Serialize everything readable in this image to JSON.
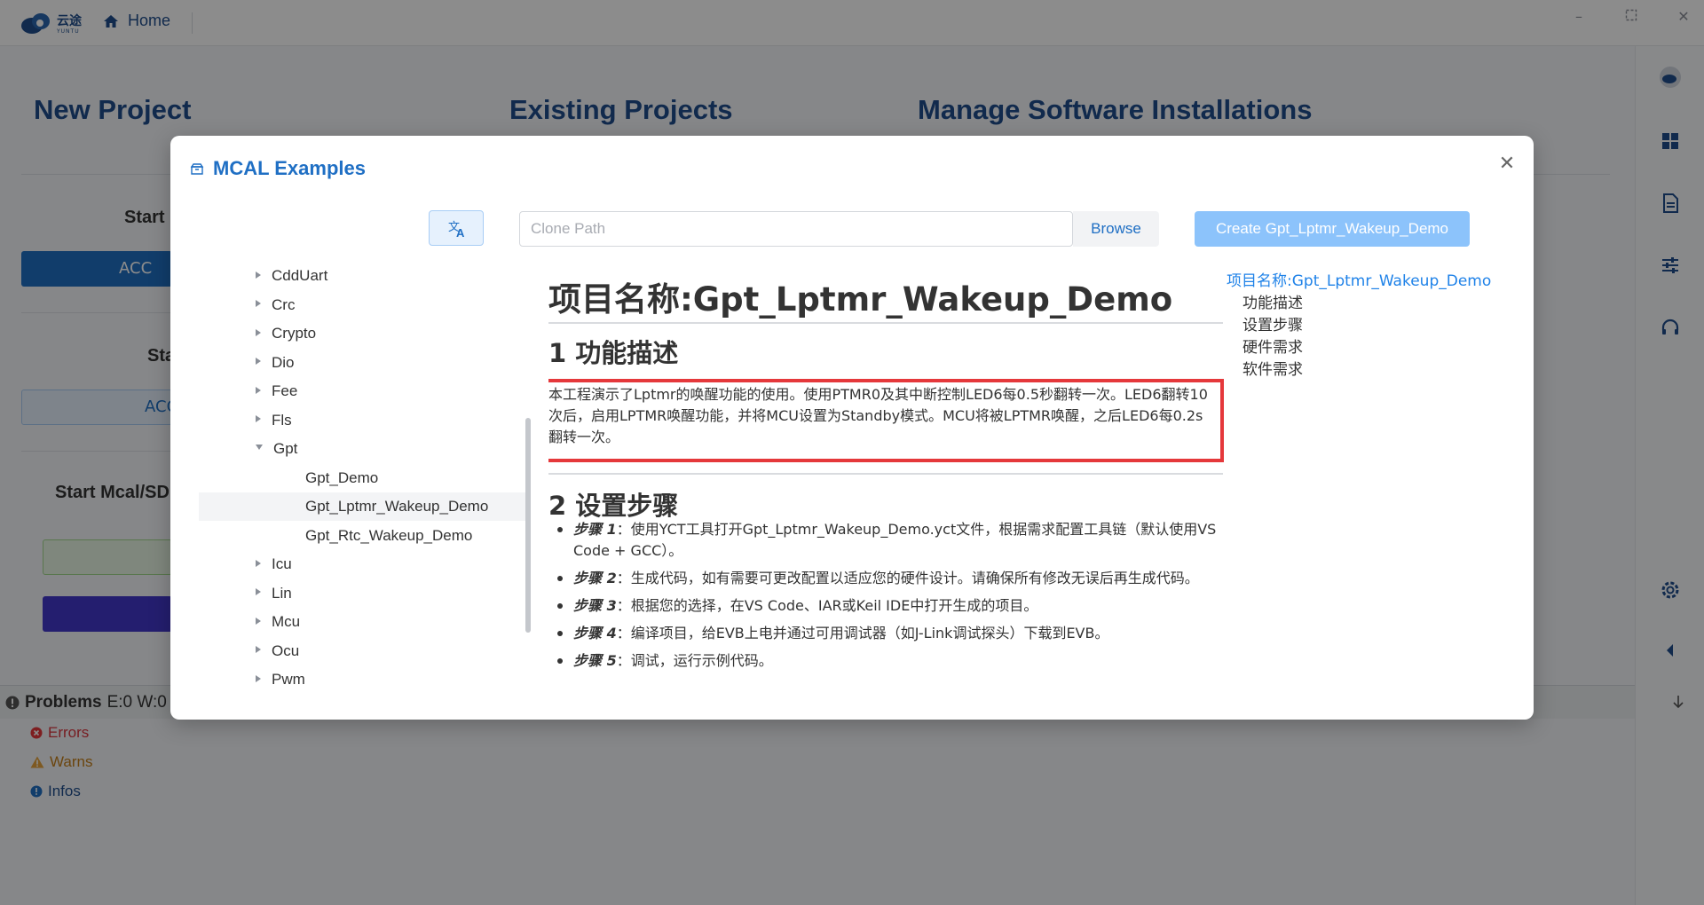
{
  "app": {
    "brand": "云途",
    "brand_sub": "YUNTU",
    "home_label": "Home"
  },
  "sections": {
    "new_project": "New Project",
    "existing_projects": "Existing Projects",
    "manage_software": "Manage Software Installations"
  },
  "background": {
    "start_label": "Start",
    "start_btn_1": "ACC",
    "sta_label": "Sta",
    "start_btn_2": "ACC",
    "start_mcal_label": "Start Mcal/SD"
  },
  "problems": {
    "title": "Problems",
    "counts": "E:0 W:0",
    "errors": "Errors",
    "warns": "Warns",
    "infos": "Infos"
  },
  "modal": {
    "title": "MCAL Examples",
    "clone_placeholder": "Clone Path",
    "browse_label": "Browse",
    "create_label": "Create Gpt_Lptmr_Wakeup_Demo"
  },
  "tree": [
    {
      "label": "CddUart",
      "level": 0,
      "expanded": false,
      "selected": false
    },
    {
      "label": "Crc",
      "level": 0,
      "expanded": false,
      "selected": false
    },
    {
      "label": "Crypto",
      "level": 0,
      "expanded": false,
      "selected": false
    },
    {
      "label": "Dio",
      "level": 0,
      "expanded": false,
      "selected": false
    },
    {
      "label": "Fee",
      "level": 0,
      "expanded": false,
      "selected": false
    },
    {
      "label": "Fls",
      "level": 0,
      "expanded": false,
      "selected": false
    },
    {
      "label": "Gpt",
      "level": 0,
      "expanded": true,
      "selected": false
    },
    {
      "label": "Gpt_Demo",
      "level": 1,
      "expanded": false,
      "selected": false
    },
    {
      "label": "Gpt_Lptmr_Wakeup_Demo",
      "level": 1,
      "expanded": false,
      "selected": true
    },
    {
      "label": "Gpt_Rtc_Wakeup_Demo",
      "level": 1,
      "expanded": false,
      "selected": false
    },
    {
      "label": "Icu",
      "level": 0,
      "expanded": false,
      "selected": false
    },
    {
      "label": "Lin",
      "level": 0,
      "expanded": false,
      "selected": false
    },
    {
      "label": "Mcu",
      "level": 0,
      "expanded": false,
      "selected": false
    },
    {
      "label": "Ocu",
      "level": 0,
      "expanded": false,
      "selected": false
    },
    {
      "label": "Pwm",
      "level": 0,
      "expanded": false,
      "selected": false
    }
  ],
  "doc": {
    "h1": "项目名称:Gpt_Lptmr_Wakeup_Demo",
    "h2_1": "1 功能描述",
    "description": "本工程演示了Lptmr的唤醒功能的使用。使用PTMR0及其中断控制LED6每0.5秒翻转一次。LED6翻转10次后，启用LPTMR唤醒功能，并将MCU设置为Standby模式。MCU将被LPTMR唤醒，之后LED6每0.2s翻转一次。",
    "h2_2": "2 设置步骤",
    "steps": [
      {
        "label": "步骤 1",
        "text": "：使用YCT工具打开Gpt_Lptmr_Wakeup_Demo.yct文件，根据需求配置工具链（默认使用VS Code + GCC）。"
      },
      {
        "label": "步骤 2",
        "text": "：生成代码，如有需要可更改配置以适应您的硬件设计。请确保所有修改无误后再生成代码。"
      },
      {
        "label": "步骤 3",
        "text": "：根据您的选择，在VS Code、IAR或Keil IDE中打开生成的项目。"
      },
      {
        "label": "步骤 4",
        "text": "：编译项目，给EVB上电并通过可用调试器（如J-Link调试探头）下载到EVB。"
      },
      {
        "label": "步骤 5",
        "text": "：调试，运行示例代码。"
      }
    ]
  },
  "toc": [
    {
      "label": "项目名称:Gpt_Lptmr_Wakeup_Demo",
      "active": true,
      "sub": false
    },
    {
      "label": "功能描述",
      "active": false,
      "sub": true
    },
    {
      "label": "设置步骤",
      "active": false,
      "sub": true
    },
    {
      "label": "硬件需求",
      "active": false,
      "sub": true
    },
    {
      "label": "软件需求",
      "active": false,
      "sub": true
    }
  ],
  "colors": {
    "brand_blue": "#1f4e8c",
    "link_blue": "#1f6fc4",
    "create_btn": "#8cc3fb",
    "highlight_red": "#e5383b"
  },
  "icons": {
    "translate": "translate-icon",
    "close": "close-icon",
    "home": "home-icon"
  }
}
